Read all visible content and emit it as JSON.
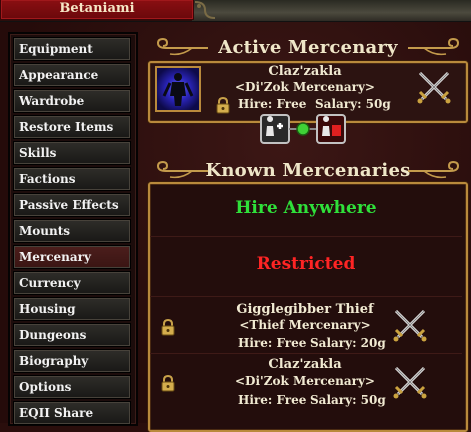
{
  "window": {
    "title": "Betaniami"
  },
  "sidebar": {
    "items": [
      {
        "label": "Equipment"
      },
      {
        "label": "Appearance"
      },
      {
        "label": "Wardrobe"
      },
      {
        "label": "Restore Items"
      },
      {
        "label": "Skills"
      },
      {
        "label": "Factions"
      },
      {
        "label": "Passive Effects"
      },
      {
        "label": "Mounts"
      },
      {
        "label": "Mercenary"
      },
      {
        "label": "Currency"
      },
      {
        "label": "Housing"
      },
      {
        "label": "Dungeons"
      },
      {
        "label": "Biography"
      },
      {
        "label": "Options"
      },
      {
        "label": "EQII Share"
      }
    ],
    "selected": "Mercenary"
  },
  "active_mercenary": {
    "header": "Active Mercenary",
    "name": "Claz'zakla",
    "type": "<Di'Zok Mercenary>",
    "hire": "Hire: Free",
    "salary": "Salary: 50g"
  },
  "known_mercenaries": {
    "header": "Known Mercenaries",
    "hire_anywhere": "Hire Anywhere",
    "restricted": "Restricted",
    "list": [
      {
        "name": "Gigglegibber Thief",
        "type": "<Thief Mercenary>",
        "hire": "Hire: Free",
        "salary": "Salary: 20g"
      },
      {
        "name": "Claz'zakla",
        "type": "<Di'Zok Mercenary>",
        "hire": "Hire: Free",
        "salary": "Salary: 50g"
      }
    ]
  },
  "colors": {
    "gold_border": "#b98a3c",
    "hire_anywhere": "#2fe03a",
    "restricted": "#ff2424",
    "title_tab": "#8a0f12"
  }
}
